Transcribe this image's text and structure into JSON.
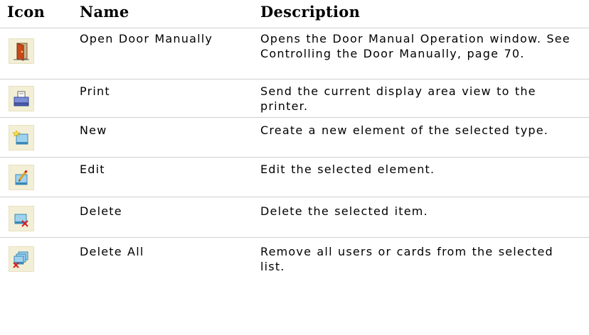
{
  "headers": {
    "icon": "Icon",
    "name": "Name",
    "description": "Description"
  },
  "rows": [
    {
      "icon": "open-door-icon",
      "name": "Open Door Manually",
      "description": "Opens the Door Manual Operation window. See Controlling the Door Manually, page 70."
    },
    {
      "icon": "print-icon",
      "name": "Print",
      "description": "Send the current display area view to the printer."
    },
    {
      "icon": "new-icon",
      "name": "New",
      "description": "Create a new element of the selected type."
    },
    {
      "icon": "edit-icon",
      "name": "Edit",
      "description": "Edit the selected element."
    },
    {
      "icon": "delete-icon",
      "name": "Delete",
      "description": "Delete the selected item."
    },
    {
      "icon": "delete-all-icon",
      "name": "Delete All",
      "description": "Remove all users or cards from the selected list."
    }
  ]
}
